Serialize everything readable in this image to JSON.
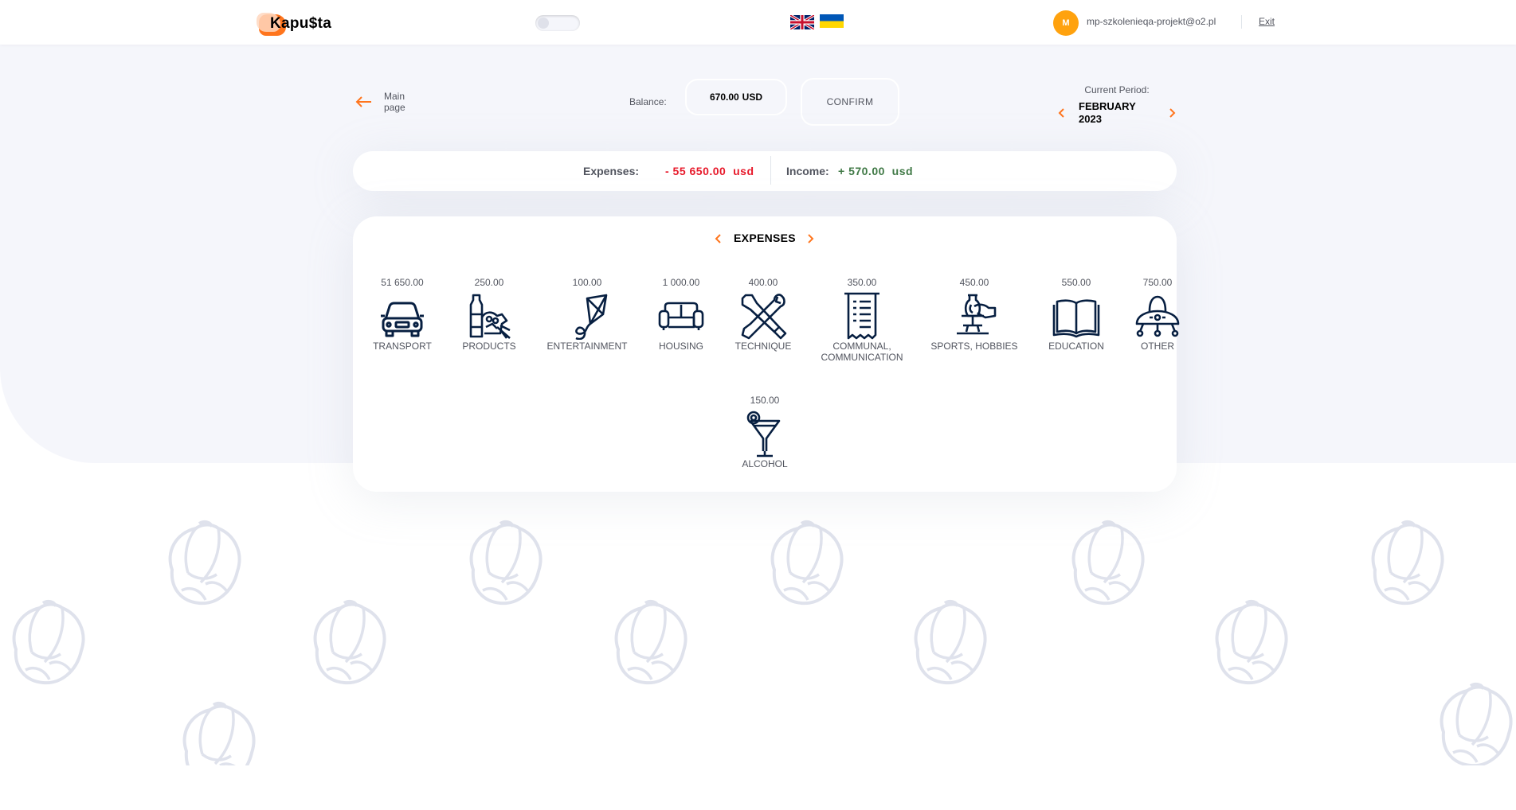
{
  "header": {
    "logo": "Kapu$ta",
    "avatar_initial": "M",
    "email": "mp-szkolenieqa-projekt@o2.pl",
    "exit": "Exit"
  },
  "controls": {
    "back_label_1": "Main",
    "back_label_2": "page",
    "balance_label": "Balance:",
    "balance_value": "670.00",
    "balance_currency": "USD",
    "confirm": "CONFIRM",
    "period_title": "Current Period:",
    "period_month": "FEBRUARY",
    "period_year": "2023"
  },
  "summary": {
    "expenses_label": "Expenses:",
    "expenses_value": "- 55 650.00  usd",
    "income_label": "Income:",
    "income_value": "+ 570.00  usd"
  },
  "panel": {
    "title": "EXPENSES",
    "categories": [
      {
        "amount": "51 650.00",
        "name": "TRANSPORT",
        "icon": "car-icon"
      },
      {
        "amount": "250.00",
        "name": "PRODUCTS",
        "icon": "groceries-icon"
      },
      {
        "amount": "100.00",
        "name": "ENTERTAINMENT",
        "icon": "kite-icon"
      },
      {
        "amount": "1 000.00",
        "name": "HOUSING",
        "icon": "sofa-icon"
      },
      {
        "amount": "400.00",
        "name": "TECHNIQUE",
        "icon": "tools-icon"
      },
      {
        "amount": "350.00",
        "name": "COMMUNAL, COMMUNICATION",
        "icon": "receipt-icon"
      },
      {
        "amount": "450.00",
        "name": "SPORTS, HOBBIES",
        "icon": "pottery-icon"
      },
      {
        "amount": "550.00",
        "name": "EDUCATION",
        "icon": "book-icon"
      },
      {
        "amount": "750.00",
        "name": "OTHER",
        "icon": "ufo-icon"
      },
      {
        "amount": "150.00",
        "name": "ALCOHOL",
        "icon": "cocktail-icon"
      }
    ]
  },
  "colors": {
    "accent": "#ff751d",
    "expense": "#e7192a",
    "income": "#407946",
    "background": "#f5f6fb",
    "avatar": "#ffa20e"
  }
}
